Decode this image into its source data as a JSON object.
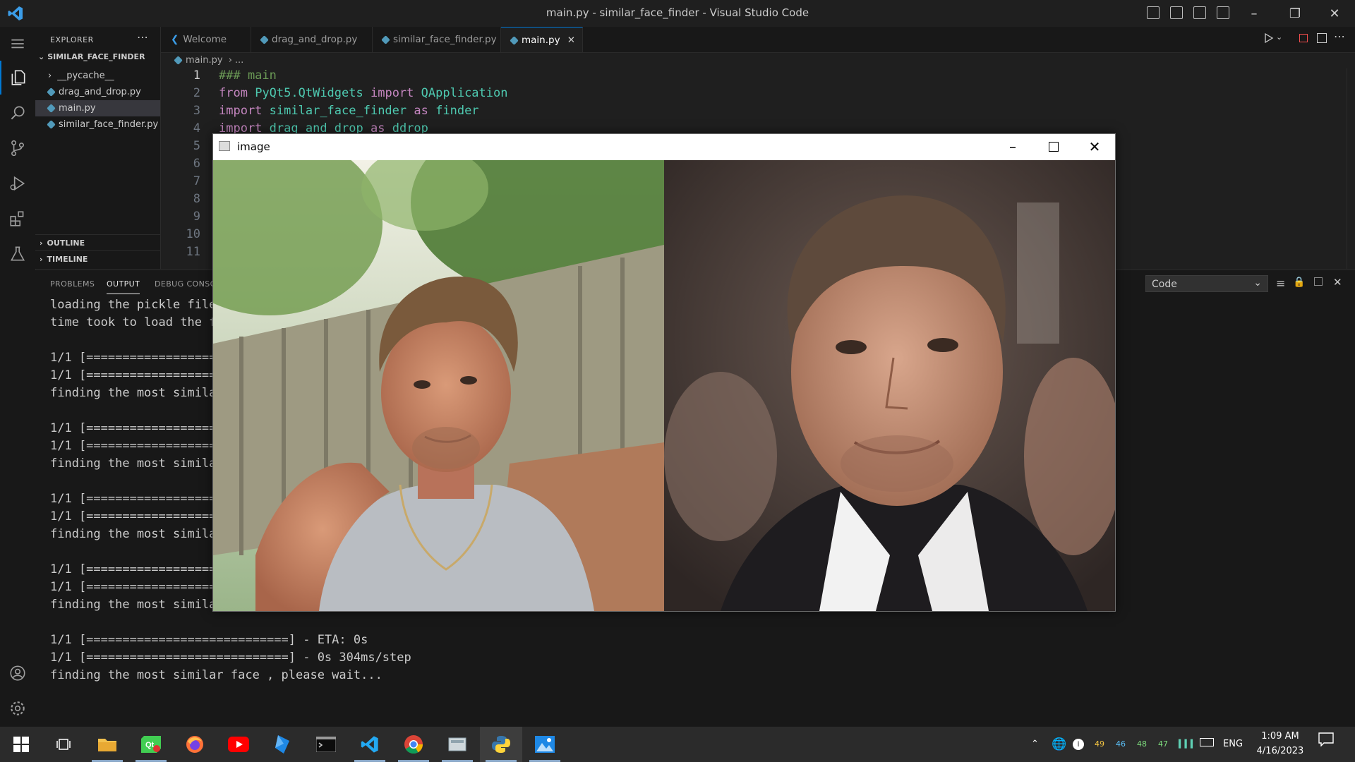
{
  "window": {
    "title": "main.py - similar_face_finder - Visual Studio Code"
  },
  "sidebar": {
    "header": "EXPLORER",
    "root": "SIMILAR_FACE_FINDER",
    "items": [
      {
        "label": "__pycache__",
        "type": "folder"
      },
      {
        "label": "drag_and_drop.py",
        "type": "file"
      },
      {
        "label": "main.py",
        "type": "file",
        "selected": true
      },
      {
        "label": "similar_face_finder.py",
        "type": "file"
      }
    ],
    "outline": "OUTLINE",
    "timeline": "TIMELINE"
  },
  "tabs": [
    {
      "label": "Welcome",
      "icon": "vscode-icon"
    },
    {
      "label": "drag_and_drop.py",
      "icon": "python-icon"
    },
    {
      "label": "similar_face_finder.py",
      "icon": "python-icon"
    },
    {
      "label": "main.py",
      "icon": "python-icon",
      "active": true
    }
  ],
  "breadcrumb": {
    "file": "main.py",
    "rest": "..."
  },
  "editor": {
    "line_numbers": [
      "1",
      "2",
      "3",
      "4",
      "5",
      "6",
      "7",
      "8",
      "9",
      "10",
      "11"
    ],
    "lines": [
      "### main",
      "from PyQt5.QtWidgets import QApplication",
      "import similar_face_finder as finder",
      "import drag_and_drop as ddrop"
    ]
  },
  "panel": {
    "tabs": [
      "PROBLEMS",
      "OUTPUT",
      "DEBUG CONSOLE"
    ],
    "active_tab": "OUTPUT",
    "output_channel": "Code",
    "lines": [
      "loading the pickle file",
      "time took to load the file",
      "",
      "1/1 [==============================] - ETA: 0s",
      "1/1 [==============================] - 0s 304ms/step",
      "finding the most similar face , please wait...",
      "",
      "1/1 [==============================] - ETA: 0s",
      "1/1 [==============================] - 0s 304ms/step",
      "finding the most similar face , please wait...",
      "",
      "1/1 [==============================] - ETA: 0s",
      "1/1 [==============================] - 0s 304ms/step",
      "finding the most similar face , please wait...",
      "",
      "1/1 [==============================] - ETA: 0s",
      "1/1 [==============================] - 0s 304ms/step",
      "finding the most similar face , please wait...",
      "",
      "1/1 [============================] - ETA: 0s",
      "1/1 [============================] - 0s 304ms/step",
      "finding the most similar face , please wait..."
    ]
  },
  "image_window": {
    "title": "image"
  },
  "taskbar": {
    "apps": [
      "start-icon",
      "task-view-icon",
      "file-explorer-icon",
      "qt-icon",
      "firefox-icon",
      "youtube-icon",
      "app-icon",
      "terminal-icon",
      "vscode-icon",
      "chrome-icon",
      "files-icon",
      "python-icon",
      "photos-icon"
    ],
    "tray": {
      "nums": [
        "49",
        "46",
        "48",
        "47"
      ],
      "lang": "ENG",
      "time": "1:09 AM",
      "date": "4/16/2023"
    }
  },
  "colors": {
    "accent": "#0078d4",
    "background": "#1f1f1f"
  }
}
